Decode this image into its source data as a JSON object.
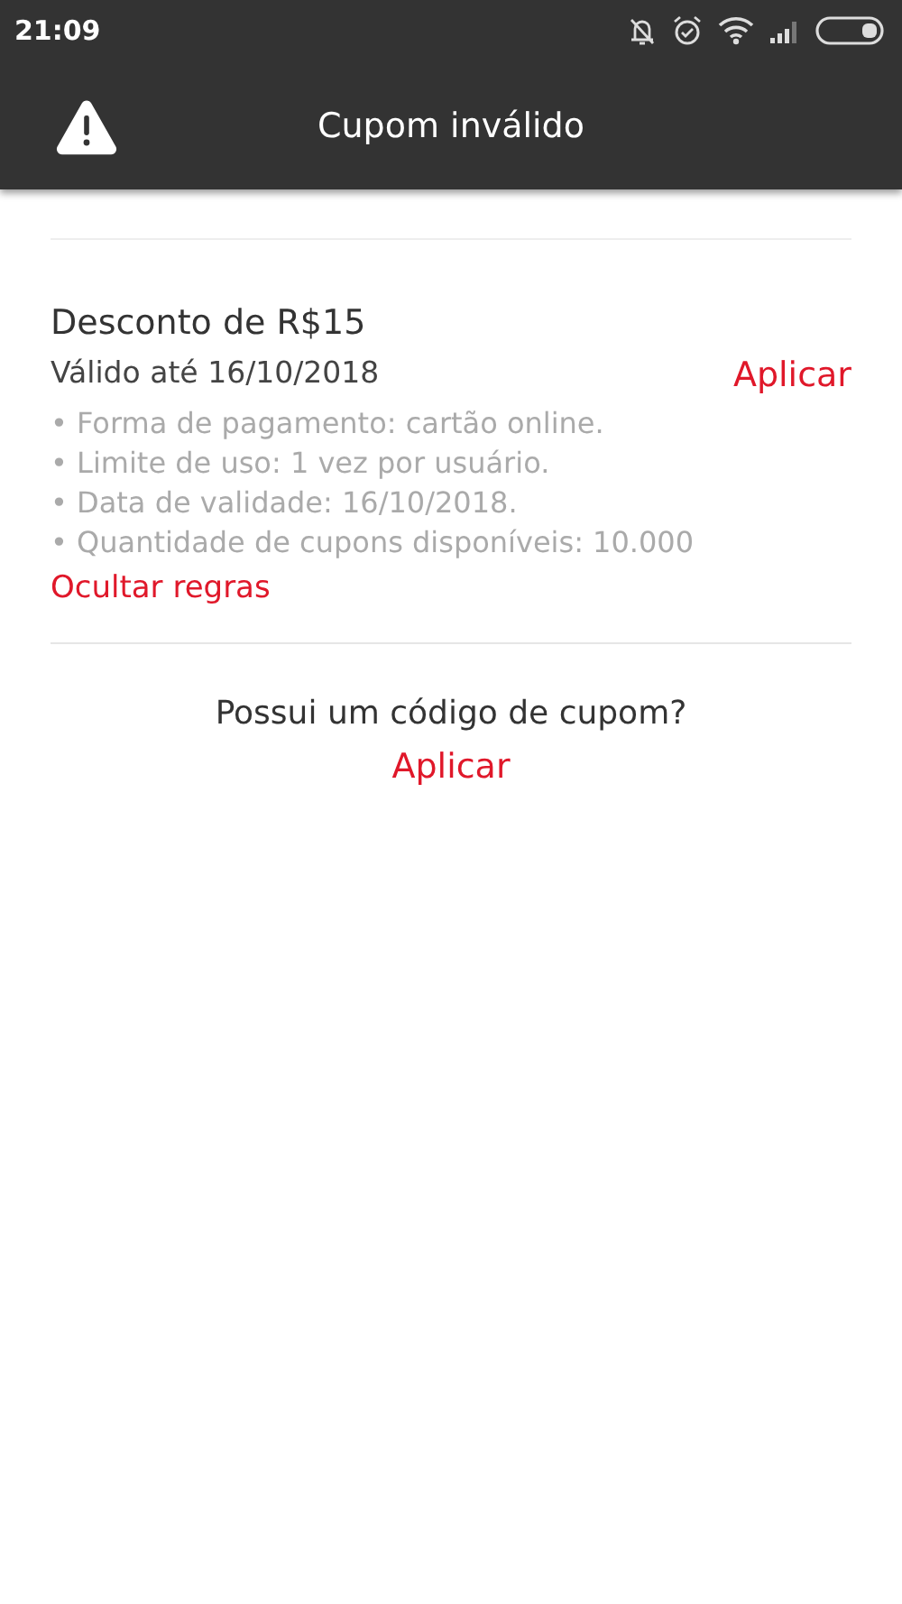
{
  "status_bar": {
    "time": "21:09"
  },
  "toolbar": {
    "title": "Cupom inválido"
  },
  "coupon": {
    "title": "Desconto de R$15",
    "validity": "Válido até 16/10/2018",
    "apply": "Aplicar",
    "rules": [
      "• Forma de pagamento: cartão online.",
      "• Limite de uso: 1 vez por usuário.",
      "• Data de validade: 16/10/2018.",
      "• Quantidade de cupons disponíveis: 10.000"
    ],
    "toggle_rules": "Ocultar regras"
  },
  "code_prompt": {
    "question": "Possui um código de cupom?",
    "apply": "Aplicar"
  }
}
